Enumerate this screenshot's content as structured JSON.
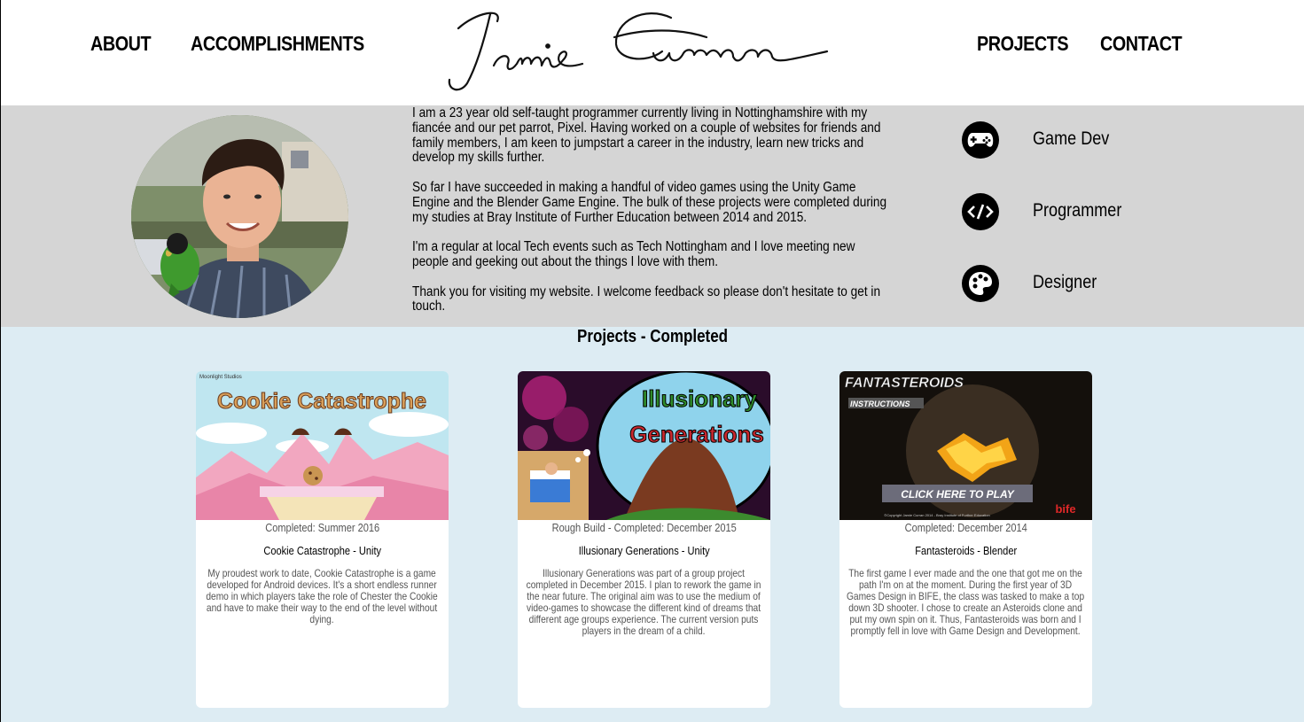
{
  "header": {
    "nav_left": [
      "ABOUT",
      "ACCOMPLISHMENTS"
    ],
    "nav_right": [
      "PROJECTS",
      "CONTACT"
    ],
    "logo_text": "Jamie Curran"
  },
  "about": {
    "paragraphs": [
      "I am a 23 year old self-taught programmer currently living in Nottinghamshire with my fiancée and our pet parrot, Pixel. Having worked on a couple of websites for friends and family members, I am keen to jumpstart a career in the industry, learn new tricks and develop my skills further.",
      "So far I have succeeded in making a handful of video games using the Unity Game Engine and the Blender Game Engine. The bulk of these projects were completed during my studies at Bray Institute of Further Education between 2014 and 2015.",
      "I'm a regular at local Tech events such as Tech Nottingham and I love meeting new people and geeking out about the things I love with them.",
      "Thank you for visiting my website. I welcome feedback so please don't hesitate to get in touch."
    ],
    "skills": [
      {
        "label": "Game Dev",
        "icon": "gamepad-icon"
      },
      {
        "label": "Programmer",
        "icon": "code-icon"
      },
      {
        "label": "Designer",
        "icon": "palette-icon"
      }
    ]
  },
  "projects": {
    "title": "Projects - Completed",
    "cards": [
      {
        "image_text": "Cookie Catastrophe",
        "image_badge": "Moonlight Studios",
        "date": "Completed: Summer 2016",
        "title": "Cookie Catastrophe - Unity",
        "desc": "My proudest work to date, Cookie Catastrophe is a game developed for Android devices. It's a short endless runner demo in which players take the role of Chester the Cookie and have to make their way to the end of the level without dying."
      },
      {
        "image_text_1": "Illusionary",
        "image_text_2": "Generations",
        "date": "Rough Build - Completed: December 2015",
        "title": "Illusionary Generations - Unity",
        "desc": "Illusionary Generations was part of a group project completed in December 2015. I plan to rework the game in the near future. The original aim was to use the medium of video-games to showcase the different kind of dreams that different age groups experience. The current version puts players in the dream of a child."
      },
      {
        "image_title": "FANTASTEROIDS",
        "image_sub": "INSTRUCTIONS",
        "image_button": "CLICK HERE TO PLAY",
        "image_copyright": "©Copyright Jamie Curran 2014 - Bray Institute of Further Education",
        "image_logo": "bife",
        "date": "Completed: December 2014",
        "title": "Fantasteroids - Blender",
        "desc": "The first game I ever made and the one that got me on the path I'm on at the moment. During the first year of 3D Games Design in BIFE, the class was tasked to make a top down 3D shooter. I chose to create an Asteroids clone and put my own spin on it. Thus, Fantasteroids was born and I promptly fell in love with Game Design and Development."
      }
    ]
  }
}
